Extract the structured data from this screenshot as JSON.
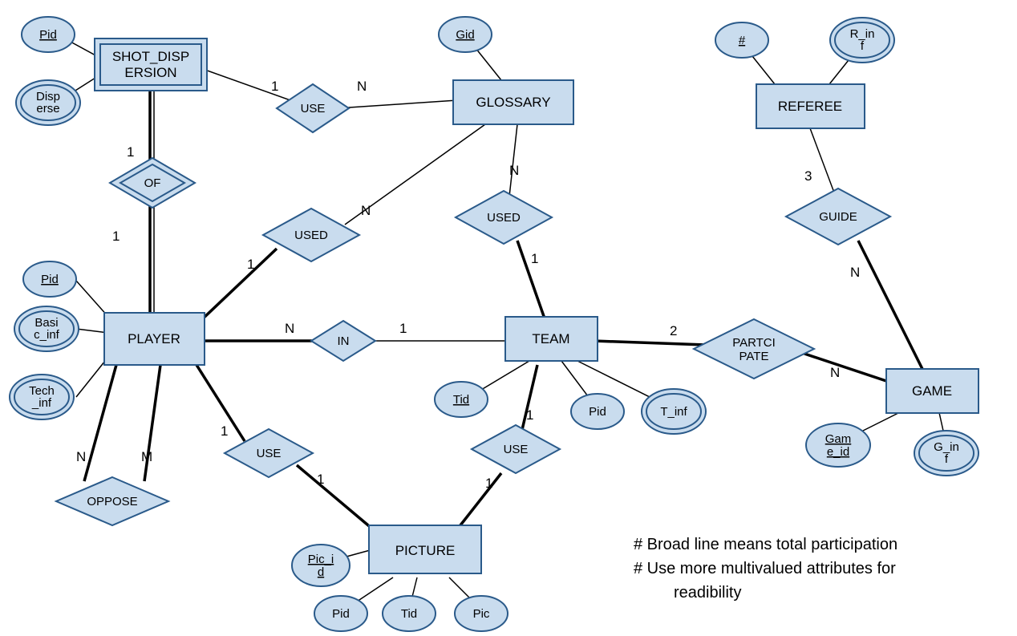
{
  "entities": {
    "shot_dispersion": "SHOT_DISPERSION",
    "glossary": "GLOSSARY",
    "referee": "REFEREE",
    "player": "PLAYER",
    "team": "TEAM",
    "game": "GAME",
    "picture": "PICTURE"
  },
  "relationships": {
    "use1": "USE",
    "of": "OF",
    "used1": "USED",
    "used2": "USED",
    "in": "IN",
    "participate": "PARTCIPATE",
    "guide": "GUIDE",
    "oppose": "OPPOSE",
    "use2": "USE",
    "use3": "USE"
  },
  "attributes": {
    "sd_pid": "Pid",
    "sd_disperse": "Disperse",
    "gl_gid": "Gid",
    "ref_num": "#",
    "ref_rinf": "R_inf",
    "pl_pid": "Pid",
    "pl_basic": "Basic_inf",
    "pl_tech": "Tech_inf",
    "tm_tid": "Tid",
    "tm_pid": "Pid",
    "tm_tinf": "T_inf",
    "gm_id": "Game_id",
    "gm_ginf": "G_inf",
    "pic_id": "Pic_id",
    "pic_pid": "Pid",
    "pic_tid": "Tid",
    "pic_pic": "Pic"
  },
  "card": {
    "use1_sd": "1",
    "use1_gl": "N",
    "of_sd": "1",
    "of_pl": "1",
    "used1_pl": "1",
    "used1_gl": "N",
    "used2_gl": "N",
    "used2_tm": "1",
    "in_pl": "N",
    "in_tm": "1",
    "part_tm": "2",
    "part_gm": "N",
    "guide_ref": "3",
    "guide_gm": "N",
    "opp_n": "N",
    "opp_m": "M",
    "use2_pl": "1",
    "use2_pic": "1",
    "use3_tm": "1",
    "use3_pic": "1"
  },
  "notes": {
    "n1": "# Broad line means  total participation",
    "n2": "# Use more multivalued attributes for",
    "n3": "readibility"
  }
}
